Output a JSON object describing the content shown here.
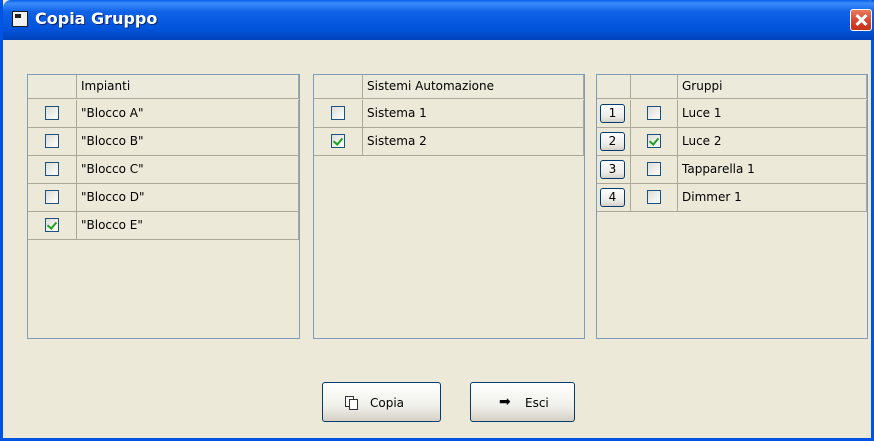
{
  "window": {
    "title": "Copia Gruppo"
  },
  "impianti": {
    "header": "Impianti",
    "rows": [
      {
        "label": "\"Blocco A\"",
        "checked": false
      },
      {
        "label": "\"Blocco B\"",
        "checked": false
      },
      {
        "label": "\"Blocco C\"",
        "checked": false
      },
      {
        "label": "\"Blocco D\"",
        "checked": false
      },
      {
        "label": "\"Blocco E\"",
        "checked": true
      }
    ]
  },
  "sistemi": {
    "header": "Sistemi Automazione",
    "rows": [
      {
        "label": "Sistema 1",
        "checked": false
      },
      {
        "label": "Sistema 2",
        "checked": true
      }
    ]
  },
  "gruppi": {
    "header": "Gruppi",
    "rows": [
      {
        "num": "1",
        "label": "Luce 1",
        "checked": false
      },
      {
        "num": "2",
        "label": "Luce 2",
        "checked": true
      },
      {
        "num": "3",
        "label": "Tapparella 1",
        "checked": false
      },
      {
        "num": "4",
        "label": "Dimmer 1",
        "checked": false
      }
    ]
  },
  "buttons": {
    "copia": "Copia",
    "esci": "Esci"
  },
  "colors": {
    "title_bar": "#0054e3",
    "check": "#21a121",
    "window_bg": "#ece9d8"
  }
}
